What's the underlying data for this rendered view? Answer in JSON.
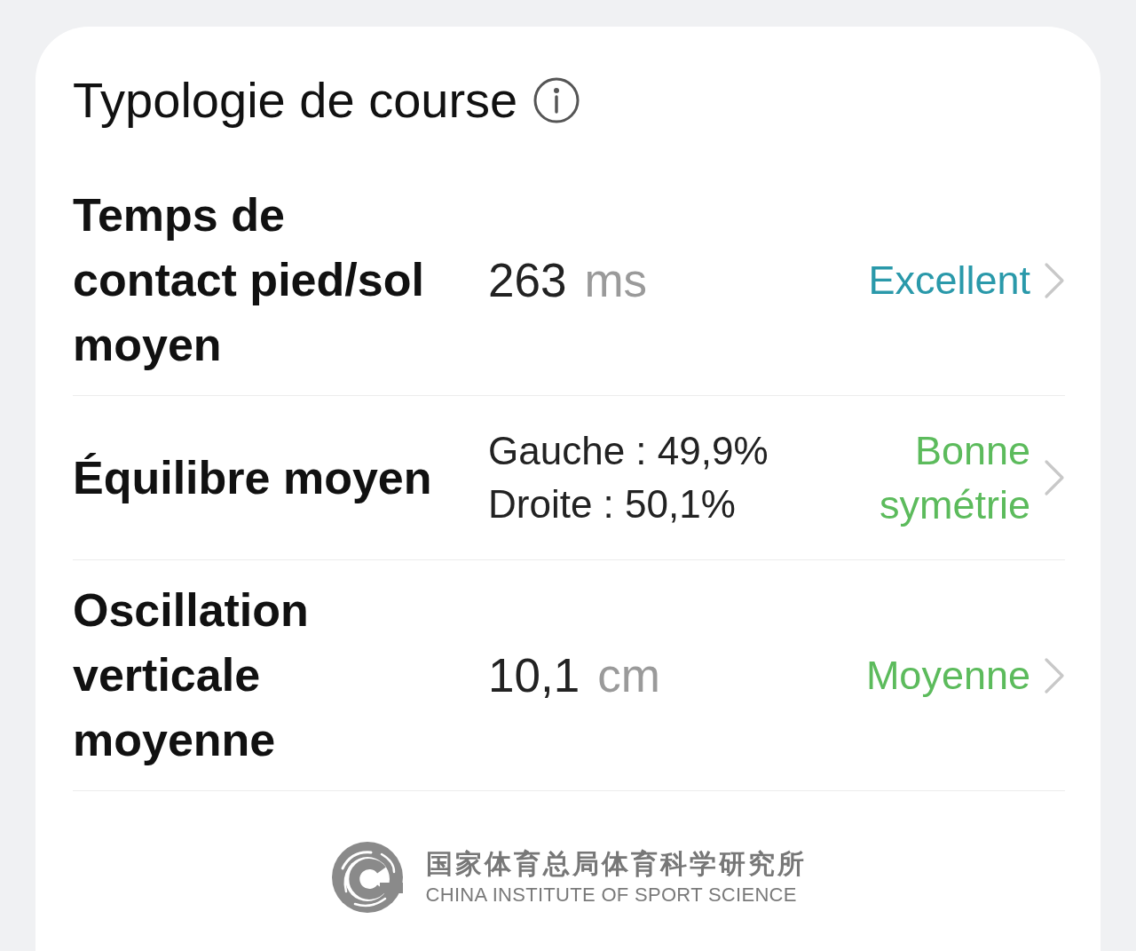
{
  "card": {
    "title": "Typologie de course",
    "metrics": [
      {
        "kind": "measure",
        "label": "Temps de contact pied/sol moyen",
        "value": "263",
        "unit": "ms",
        "rating": {
          "text": "Excellent",
          "color": "#2a99aa"
        }
      },
      {
        "kind": "balance",
        "label": "Équilibre moyen",
        "lines": [
          "Gauche : 49,9%",
          "Droite : 50,1%"
        ],
        "rating": {
          "text": "Bonne symétrie",
          "color": "#5cbb5c"
        }
      },
      {
        "kind": "measure",
        "label": "Oscillation verticale moyenne",
        "value": "10,1",
        "unit": "cm",
        "rating": {
          "text": "Moyenne",
          "color": "#5cbb5c"
        }
      }
    ]
  },
  "footer": {
    "name_zh": "国家体育总局体育科学研究所",
    "name_en": "CHINA INSTITUTE OF SPORT SCIENCE"
  }
}
